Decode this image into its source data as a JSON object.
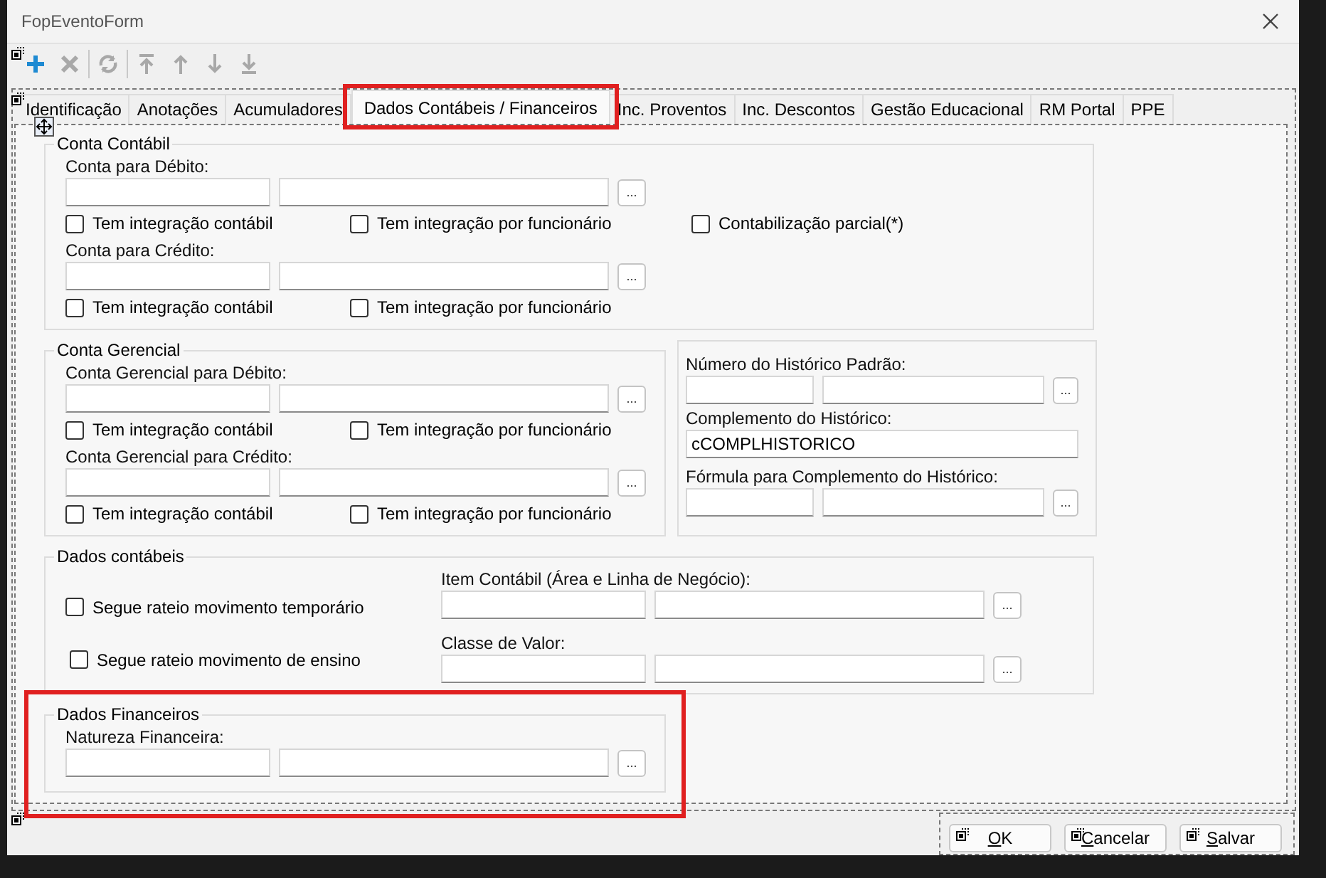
{
  "window": {
    "title": "FopEventoForm"
  },
  "toolbar": [
    [
      {
        "kind": "add",
        "disabled": false
      },
      {
        "kind": "delete",
        "disabled": true
      }
    ],
    [
      {
        "kind": "refresh",
        "disabled": true
      }
    ],
    [
      {
        "kind": "move-first",
        "disabled": true
      },
      {
        "kind": "move-up",
        "disabled": true
      },
      {
        "kind": "move-down",
        "disabled": true
      },
      {
        "kind": "move-last",
        "disabled": true
      }
    ]
  ],
  "tabs": [
    {
      "label": "Identificação",
      "selected": false,
      "highlighted": false
    },
    {
      "label": "Anotações",
      "selected": false,
      "highlighted": false
    },
    {
      "label": "Acumuladores",
      "selected": false,
      "highlighted": false
    },
    {
      "label": "Dados Contábeis / Financeiros",
      "selected": true,
      "highlighted": true
    },
    {
      "label": "Inc. Proventos",
      "selected": false,
      "highlighted": false
    },
    {
      "label": "Inc. Descontos",
      "selected": false,
      "highlighted": false
    },
    {
      "label": "Gestão Educacional",
      "selected": false,
      "highlighted": false
    },
    {
      "label": "RM Portal",
      "selected": false,
      "highlighted": false
    },
    {
      "label": "PPE",
      "selected": false,
      "highlighted": false
    }
  ],
  "section_rows": [
    [
      {
        "title": "Conta Contábil",
        "highlighted": false,
        "items": [
          {
            "kind": "label",
            "text": "Conta para Débito:"
          },
          {
            "kind": "lookup",
            "button": "..."
          },
          {
            "kind": "checks",
            "options": [
              {
                "label": "Tem integração contábil",
                "checked": false
              },
              {
                "label": "Tem integração por funcionário",
                "checked": false
              },
              {
                "label": "Contabilização parcial(*)",
                "checked": false
              }
            ]
          },
          {
            "kind": "label",
            "text": "Conta para Crédito:"
          },
          {
            "kind": "lookup",
            "button": "..."
          },
          {
            "kind": "checks",
            "options": [
              {
                "label": "Tem integração contábil",
                "checked": false
              },
              {
                "label": "Tem integração por funcionário",
                "checked": false
              }
            ]
          }
        ]
      }
    ],
    [
      {
        "title": "Conta Gerencial",
        "highlighted": false,
        "items": [
          {
            "kind": "label",
            "text": "Conta Gerencial para Débito:"
          },
          {
            "kind": "lookup",
            "button": "..."
          },
          {
            "kind": "checks",
            "options": [
              {
                "label": "Tem integração contábil",
                "checked": false
              },
              {
                "label": "Tem integração por funcionário",
                "checked": false
              }
            ]
          },
          {
            "kind": "label",
            "text": "Conta Gerencial para Crédito:"
          },
          {
            "kind": "lookup",
            "button": "..."
          },
          {
            "kind": "checks",
            "options": [
              {
                "label": "Tem integração contábil",
                "checked": false
              },
              {
                "label": "Tem integração por funcionário",
                "checked": false
              }
            ]
          }
        ]
      },
      {
        "highlighted": false,
        "items": [
          {
            "kind": "label",
            "text": "Número do Histórico Padrão:"
          },
          {
            "kind": "lookup",
            "button": "..."
          },
          {
            "kind": "label",
            "text": "Complemento do Histórico:"
          },
          {
            "kind": "text",
            "value": "cCOMPLHISTORICO"
          },
          {
            "kind": "label",
            "text": "Fórmula para Complemento do Histórico:"
          },
          {
            "kind": "lookup",
            "button": "..."
          }
        ]
      }
    ],
    [
      {
        "title": "Dados contábeis",
        "highlighted": false,
        "items": [
          {
            "kind": "columns",
            "columns": [
              [
                {
                  "kind": "checks",
                  "options": [
                    {
                      "label": "Segue rateio movimento temporário",
                      "checked": false
                    }
                  ]
                },
                {
                  "kind": "checks",
                  "options": [
                    {
                      "label": "Segue rateio movimento de ensino",
                      "checked": false
                    }
                  ]
                }
              ],
              [
                {
                  "kind": "label",
                  "text": "Item Contábil (Área e Linha de Negócio):"
                },
                {
                  "kind": "lookup",
                  "button": "..."
                },
                {
                  "kind": "label",
                  "text": "Classe de Valor:"
                },
                {
                  "kind": "lookup",
                  "button": "..."
                }
              ]
            ]
          }
        ]
      }
    ],
    [
      {
        "title": "Dados Financeiros",
        "highlighted": true,
        "items": [
          {
            "kind": "label",
            "text": "Natureza Financeira:"
          },
          {
            "kind": "lookup",
            "button": "..."
          }
        ]
      }
    ]
  ],
  "buttons": [
    {
      "label": "OK",
      "first_letter_underlined": true
    },
    {
      "label": "Cancelar",
      "first_letter_underlined": true
    },
    {
      "label": "Salvar",
      "first_letter_underlined": true
    }
  ]
}
